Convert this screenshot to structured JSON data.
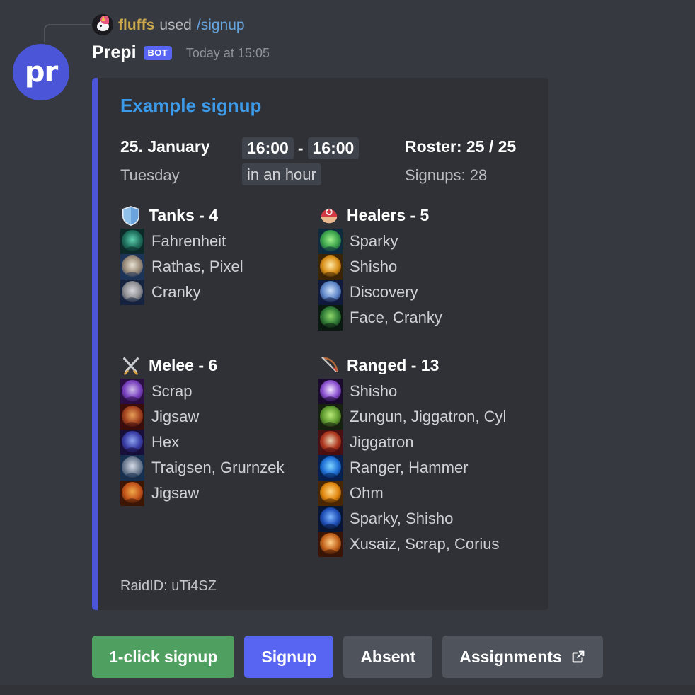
{
  "interaction": {
    "user": "fluffs",
    "used_label": "used",
    "command": "/signup",
    "user_avatar_icon": "unicorn-avatar-icon"
  },
  "message": {
    "author": "Prepi",
    "bot_tag": "BOT",
    "timestamp": "Today at 15:05",
    "avatar_initials": "pr"
  },
  "embed": {
    "accent_color": "#4a55d8",
    "title": "Example signup",
    "date": "25. January",
    "weekday": "Tuesday",
    "time_start": "16:00",
    "time_separator": "-",
    "time_end": "16:00",
    "relative_time": "in an hour",
    "roster": "Roster: 25 / 25",
    "signups": "Signups: 28",
    "footer": "RaidID: uTi4SZ",
    "groups": [
      {
        "name": "tanks",
        "icon": "shield-icon",
        "title": "Tanks - 4",
        "rows": [
          {
            "icon": "bear-form-icon",
            "names": "Fahrenheit"
          },
          {
            "icon": "protection-paladin-icon",
            "names": "Rathas, Pixel"
          },
          {
            "icon": "protection-warrior-icon",
            "names": "Cranky"
          }
        ]
      },
      {
        "name": "healers",
        "icon": "medic-helmet-icon",
        "title": "Healers - 5",
        "rows": [
          {
            "icon": "restoration-druid-icon",
            "names": "Sparky"
          },
          {
            "icon": "holy-paladin-icon",
            "names": "Shisho"
          },
          {
            "icon": "discipline-priest-icon",
            "names": "Discovery"
          },
          {
            "icon": "restoration-shaman-icon",
            "names": "Face, Cranky"
          }
        ]
      },
      {
        "name": "melee",
        "icon": "crossed-swords-icon",
        "title": "Melee - 6",
        "rows": [
          {
            "icon": "retribution-paladin-icon",
            "names": "Scrap"
          },
          {
            "icon": "feral-druid-icon",
            "names": "Jigsaw"
          },
          {
            "icon": "death-knight-icon",
            "names": "Hex"
          },
          {
            "icon": "enhancement-shaman-icon",
            "names": "Traigsen, Grurnzek"
          },
          {
            "icon": "arms-warrior-icon",
            "names": "Jigsaw"
          }
        ]
      },
      {
        "name": "ranged",
        "icon": "bow-and-arrow-icon",
        "title": "Ranged - 13",
        "rows": [
          {
            "icon": "arcane-mage-icon",
            "names": "Shisho"
          },
          {
            "icon": "warlock-icon",
            "names": "Zungun, Jiggatron, Cyl"
          },
          {
            "icon": "fire-mage-icon",
            "names": "Jiggatron"
          },
          {
            "icon": "frost-mage-icon",
            "names": "Ranger, Hammer"
          },
          {
            "icon": "shadow-priest-icon",
            "names": "Ohm"
          },
          {
            "icon": "elemental-shaman-icon",
            "names": "Sparky, Shisho"
          },
          {
            "icon": "balance-druid-icon",
            "names": "Xusaiz, Scrap, Corius"
          }
        ]
      }
    ]
  },
  "buttons": [
    {
      "name": "one-click-signup",
      "label": "1-click signup",
      "style": "success"
    },
    {
      "name": "signup",
      "label": "Signup",
      "style": "primary"
    },
    {
      "name": "absent",
      "label": "Absent",
      "style": "secondary"
    },
    {
      "name": "assignments",
      "label": "Assignments",
      "style": "secondary",
      "icon": "external-link-icon"
    }
  ]
}
